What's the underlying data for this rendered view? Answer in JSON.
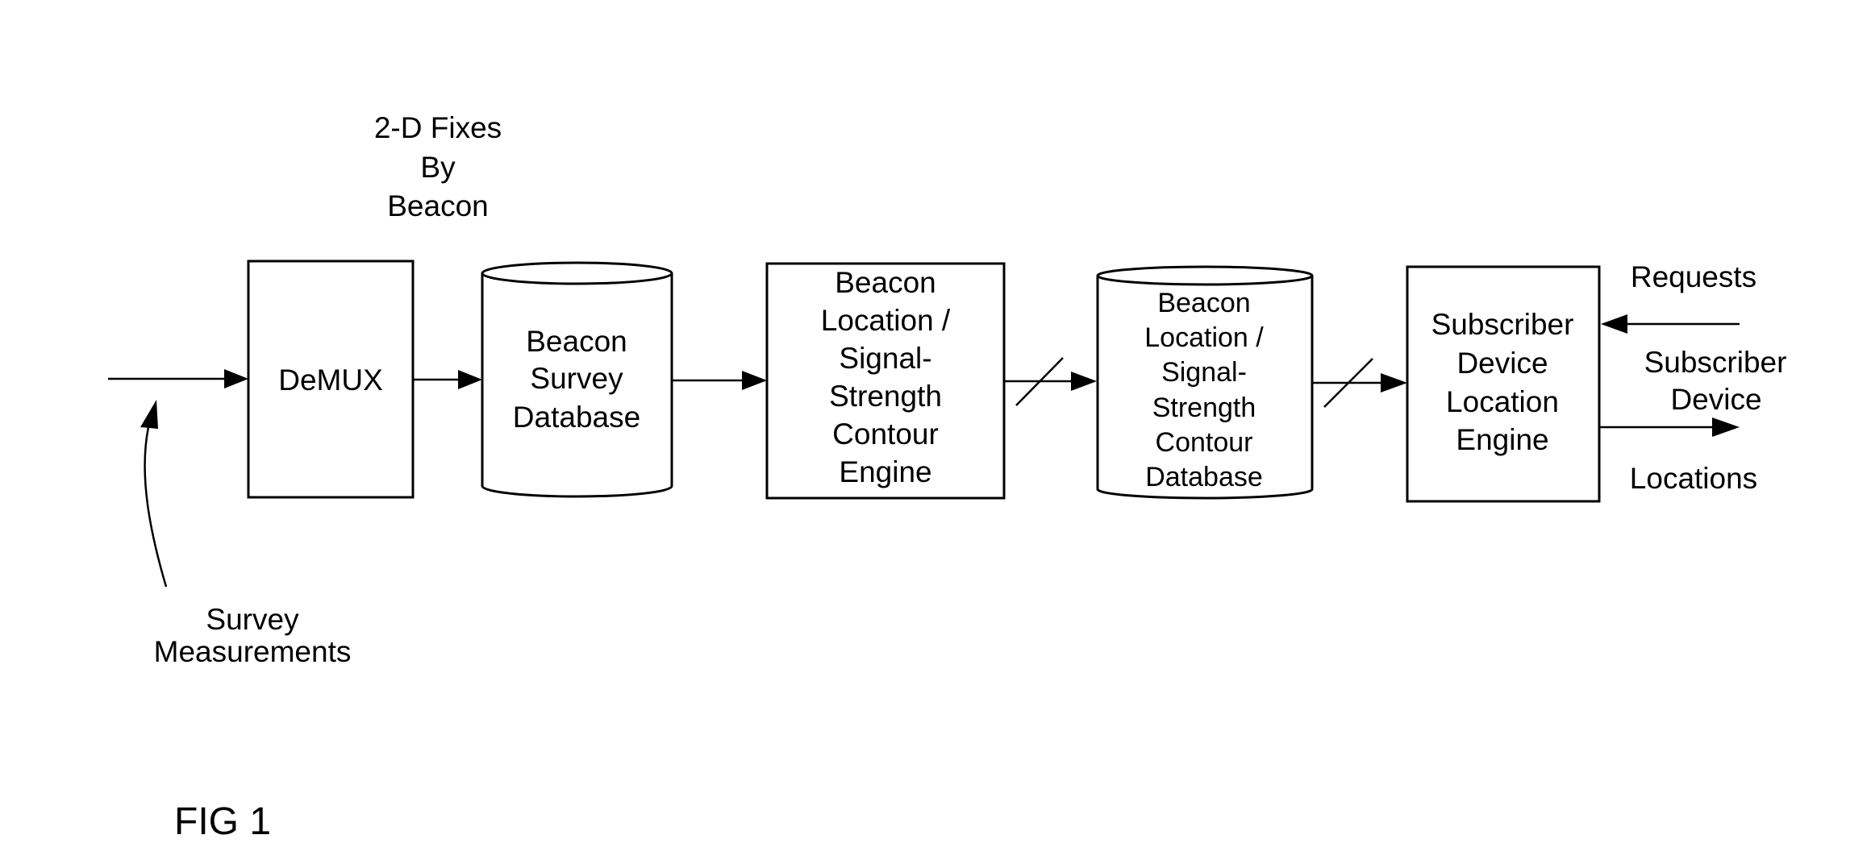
{
  "figure": {
    "label": "FIG 1"
  },
  "nodes": {
    "demux": {
      "type": "process",
      "lines": [
        "DeMUX"
      ]
    },
    "survey_db": {
      "type": "database",
      "lines": [
        "Beacon",
        "Survey",
        "Database"
      ]
    },
    "contour_engine": {
      "type": "process",
      "lines": [
        "Beacon",
        "Location /",
        "Signal-",
        "Strength",
        "Contour",
        "Engine"
      ]
    },
    "contour_db": {
      "type": "database",
      "lines": [
        "Beacon",
        "Location /",
        "Signal-",
        "Strength",
        "Contour",
        "Database"
      ]
    },
    "subscriber_engine": {
      "type": "process",
      "lines": [
        "Subscriber",
        "Device",
        "Location",
        "Engine"
      ]
    }
  },
  "labels": {
    "fixes": [
      "2-D Fixes",
      "By",
      "Beacon"
    ],
    "survey_measurements": [
      "Survey",
      "Measurements"
    ],
    "requests": "Requests",
    "subscriber_device": [
      "Subscriber",
      "Device"
    ],
    "locations": "Locations"
  },
  "edges": [
    {
      "from": "survey_measurements",
      "to": "demux",
      "style": "plain"
    },
    {
      "from": "demux",
      "to": "survey_db",
      "style": "plain"
    },
    {
      "from": "survey_db",
      "to": "contour_engine",
      "style": "plain"
    },
    {
      "from": "contour_engine",
      "to": "contour_db",
      "style": "bus"
    },
    {
      "from": "contour_db",
      "to": "subscriber_engine",
      "style": "bus"
    },
    {
      "from": "requests",
      "to": "subscriber_engine",
      "style": "plain"
    },
    {
      "from": "subscriber_engine",
      "to": "locations",
      "style": "plain"
    }
  ]
}
